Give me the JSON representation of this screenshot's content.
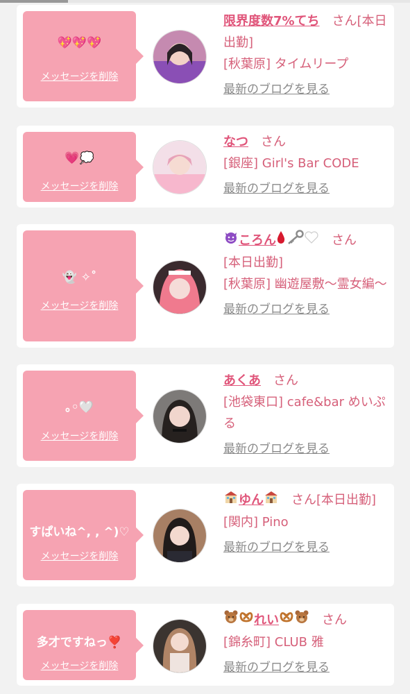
{
  "delete_label": "メッセージを削除",
  "blog_label": "最新のブログを見る",
  "san": "さん",
  "colors": {
    "bubble": "#f6a3b2",
    "name": "#e0557a",
    "text": "#d6607a",
    "link_gray": "#8a8a8a"
  },
  "cards": [
    {
      "message": "💖💖💖",
      "name": "限界度数7%てち",
      "status": "[本日出勤]",
      "shop": "[秋葉原] タイムリープ"
    },
    {
      "message": "💗💭",
      "name": "なつ",
      "status": "",
      "shop": "[銀座] Girl's Bar CODE"
    },
    {
      "message": "👻 ✧˚",
      "name_prefix_icon": "devil-face-icon",
      "name": "ころん",
      "name_suffix_icons": [
        "blood-drop-icon",
        "key-icon",
        "white-heart-icon"
      ],
      "status": "[本日出勤]",
      "shop": "[秋葉原] 幽遊屋敷〜霊女編〜"
    },
    {
      "message": "｡◦🤍",
      "name": "あくあ",
      "status": "",
      "shop": "[池袋東口] cafe&bar めいぷる"
    },
    {
      "message": "すぱいね^, , ^)♡",
      "name_prefix_icon": "school-icon",
      "name": "ゆん",
      "name_suffix_icons": [
        "school-icon"
      ],
      "status": "[本日出勤]",
      "shop": "[関内] Pino"
    },
    {
      "message": "多才ですねっ❣️",
      "name_prefix_icon": "bear-pretzel-icon",
      "name": "れい",
      "name_suffix_icons": [
        "pretzel-bear-icon"
      ],
      "status": "",
      "shop": "[錦糸町] CLUB 雅"
    }
  ]
}
